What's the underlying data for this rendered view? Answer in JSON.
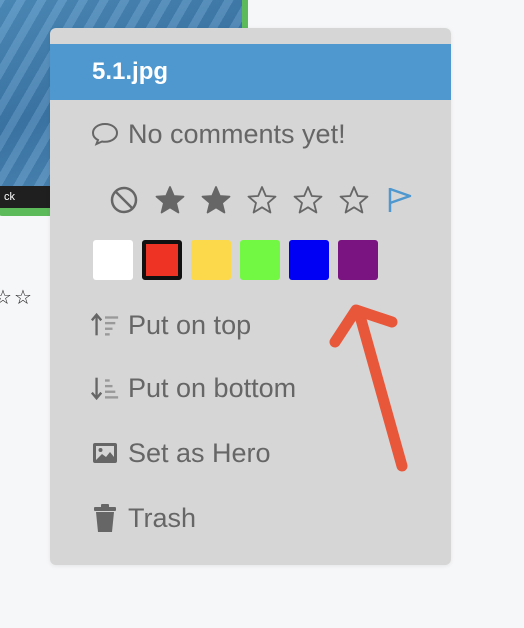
{
  "thumbnail": {
    "caption": "ck"
  },
  "background_rating": {
    "stars": [
      "☆",
      "☆"
    ]
  },
  "menu": {
    "title": "5.1.jpg",
    "comments_label": "No comments yet!",
    "rating": {
      "value": 2,
      "max": 5,
      "filled_color": "#666666",
      "clear_icon": "ban-icon",
      "flag_icon": "flag-icon",
      "flag_color": "#4e97cf"
    },
    "colors": [
      {
        "name": "white",
        "hex": "#ffffff",
        "selected": false
      },
      {
        "name": "red",
        "hex": "#ee3224",
        "selected": true
      },
      {
        "name": "yellow",
        "hex": "#fcd94a",
        "selected": false
      },
      {
        "name": "green",
        "hex": "#72f843",
        "selected": false
      },
      {
        "name": "blue",
        "hex": "#0000f5",
        "selected": false
      },
      {
        "name": "purple",
        "hex": "#7a1480",
        "selected": false
      }
    ],
    "items": {
      "put_on_top": "Put on top",
      "put_on_bottom": "Put on bottom",
      "set_as_hero": "Set as Hero",
      "trash": "Trash"
    }
  },
  "annotation": {
    "arrow_color": "#e8573a"
  }
}
